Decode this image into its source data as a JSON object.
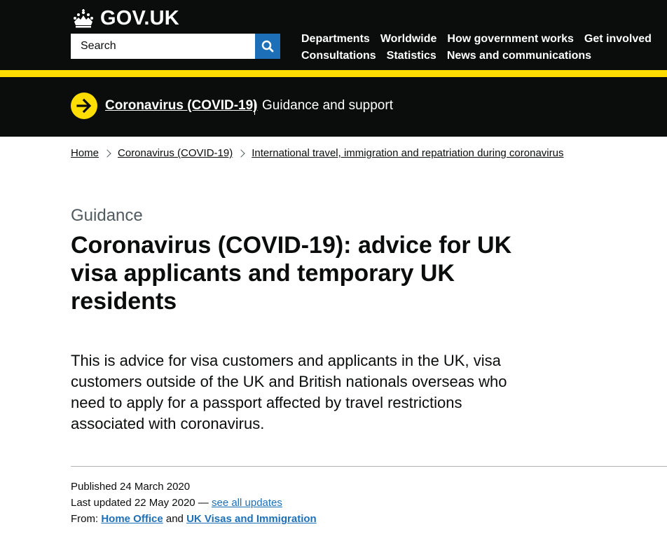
{
  "header": {
    "logo_text": "GOV.UK",
    "search": {
      "placeholder": "Search"
    },
    "nav": [
      [
        "Departments",
        "Worldwide",
        "How government works",
        "Get involved"
      ],
      [
        "Consultations",
        "Statistics",
        "News and communications"
      ]
    ]
  },
  "covid_banner": {
    "link": "Coronavirus (COVID-19)",
    "subtitle": "Guidance and support"
  },
  "breadcrumbs": [
    "Home",
    "Coronavirus (COVID-19)",
    "International travel, immigration and repatriation during coronavirus"
  ],
  "page": {
    "caption": "Guidance",
    "title": "Coronavirus (COVID-19): advice for UK visa applicants and temporary UK residents",
    "lead": "This is advice for visa customers and applicants in the UK, visa customers outside of the UK and British nationals overseas who need to apply for a passport affected by travel restrictions associated with coronavirus."
  },
  "metadata": {
    "published": "Published 24 March 2020",
    "updated_prefix": "Last updated 22 May 2020 — ",
    "see_all_updates": "see all updates",
    "from_label": "From:",
    "from_org_1": "Home Office",
    "and": " and ",
    "from_org_2": "UK Visas and Immigration"
  },
  "colors": {
    "header_bg": "#0b0c0c",
    "accent_yellow": "#ffdd00",
    "link_blue": "#1d70b8",
    "secondary_text": "#505a5f",
    "divider": "#b1b4b6"
  }
}
